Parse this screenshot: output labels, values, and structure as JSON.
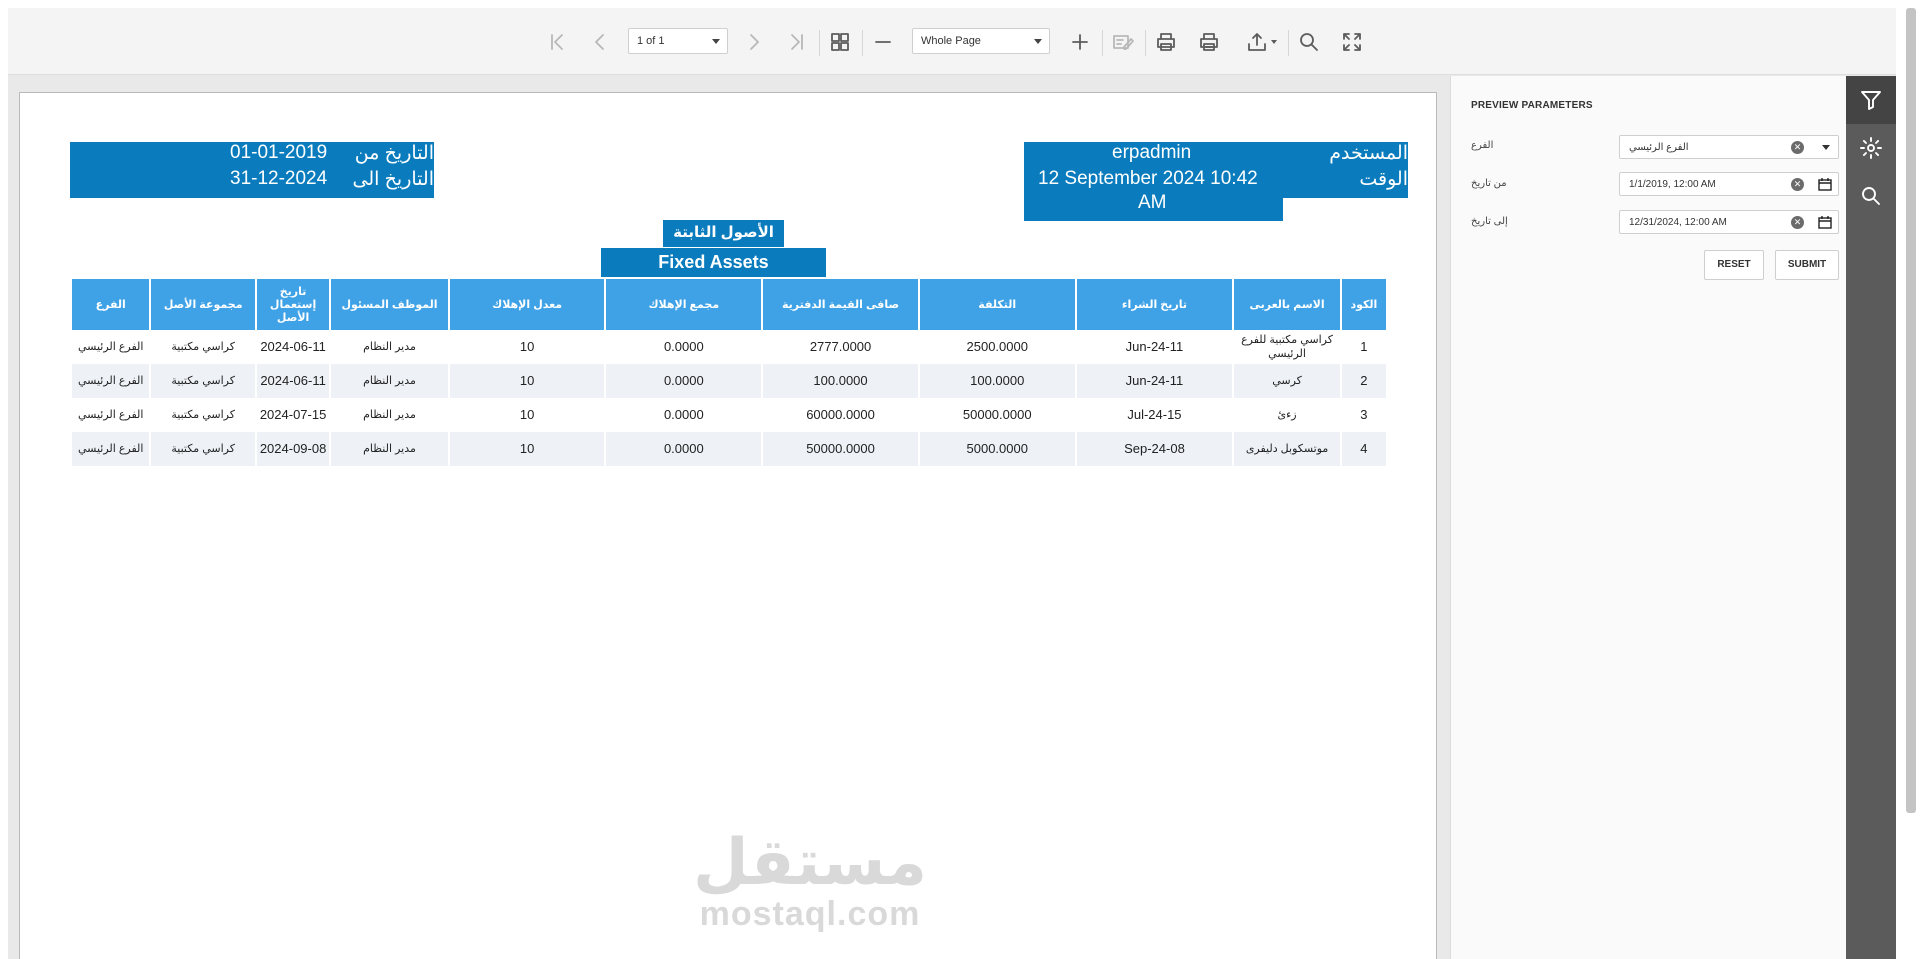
{
  "toolbar": {
    "page_value": "1 of 1",
    "zoom_value": "Whole Page"
  },
  "report": {
    "date_from_label": "التاريخ من",
    "date_from_value": "01-01-2019",
    "date_to_label": "التاريخ الى",
    "date_to_value": "31-12-2024",
    "user_label": "المستخدم",
    "user_value": "erpadmin",
    "time_label": "الوقت",
    "time_value_line1": "12 September 2024 10:42",
    "time_value_line2": "AM",
    "title_ar": "الأصول الثابتة",
    "title_en": "Fixed Assets",
    "columns": [
      "الكود",
      "الاسم بالعربى",
      "تاريخ الشراء",
      "التكلفة",
      "صافى القيمة الدفترية",
      "مجمع الإهلاك",
      "معدل الإهلاك",
      "الموظف المسئول",
      "تاريخ إستعمال الأصل",
      "مجموعة الأصل",
      "الفرع"
    ],
    "rows": [
      [
        "1",
        "كراسي مكتبية للفرع الرئيسي",
        "Jun-24-11",
        "2500.0000",
        "2777.0000",
        "0.0000",
        "10",
        "مدير النظام",
        "2024-06-11",
        "كراسي مكتبية",
        "الفرع الرئيسي"
      ],
      [
        "2",
        "كرسي",
        "Jun-24-11",
        "100.0000",
        "100.0000",
        "0.0000",
        "10",
        "مدير النظام",
        "2024-06-11",
        "كراسي مكتبية",
        "الفرع الرئيسي"
      ],
      [
        "3",
        "زءئ",
        "Jul-24-15",
        "50000.0000",
        "60000.0000",
        "0.0000",
        "10",
        "مدير النظام",
        "2024-07-15",
        "كراسي مكتبية",
        "الفرع الرئيسي"
      ],
      [
        "4",
        "موتسكوبل دليفرى",
        "Sep-24-08",
        "5000.0000",
        "50000.0000",
        "0.0000",
        "10",
        "مدير النظام",
        "2024-09-08",
        "كراسي مكتبية",
        "الفرع الرئيسي"
      ]
    ],
    "watermark_ar": "مستقل",
    "watermark_en": "mostaql.com"
  },
  "panel": {
    "title": "PREVIEW PARAMETERS",
    "branch_label": "الفرع",
    "branch_value": "الفرع الرئيسي",
    "from_label": "من تاريخ",
    "from_value": "1/1/2019, 12:00 AM",
    "to_label": "إلى تاريخ",
    "to_value": "12/31/2024, 12:00 AM",
    "reset_label": "RESET",
    "submit_label": "SUBMIT"
  },
  "icons": {
    "toolbar": [
      "first-page-icon",
      "prev-page-icon",
      "next-page-icon",
      "last-page-icon",
      "multipage-icon",
      "zoom-out-icon",
      "zoom-in-icon",
      "edit-fields-icon",
      "print-icon",
      "print-page-icon",
      "export-icon",
      "search-icon",
      "fullscreen-icon"
    ],
    "strip": [
      "filter-icon",
      "gear-icon",
      "search-icon"
    ]
  },
  "colors": {
    "header_box": "#0a7cbd",
    "table_header": "#3fa2e6",
    "row_alt": "#eef2f7",
    "strip": "#5b5b5b"
  }
}
